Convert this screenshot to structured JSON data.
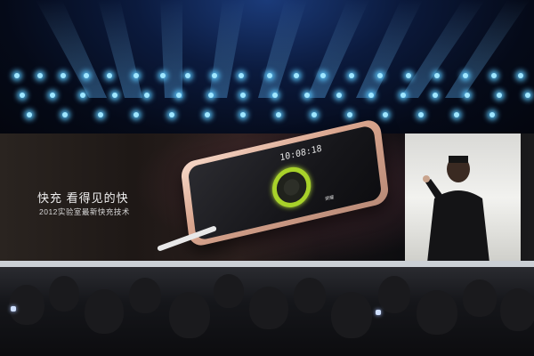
{
  "scene": "launch-event-stage",
  "slide": {
    "headline": "快充  看得见的快",
    "subline": "2012实验室最新快充技术"
  },
  "phone": {
    "time": "10:08:18",
    "brand": "荣耀"
  },
  "colors": {
    "stage_lights": "#9fe6ff",
    "charge_ring": "#a8d22a",
    "phone_body": "#e9c3b0"
  }
}
